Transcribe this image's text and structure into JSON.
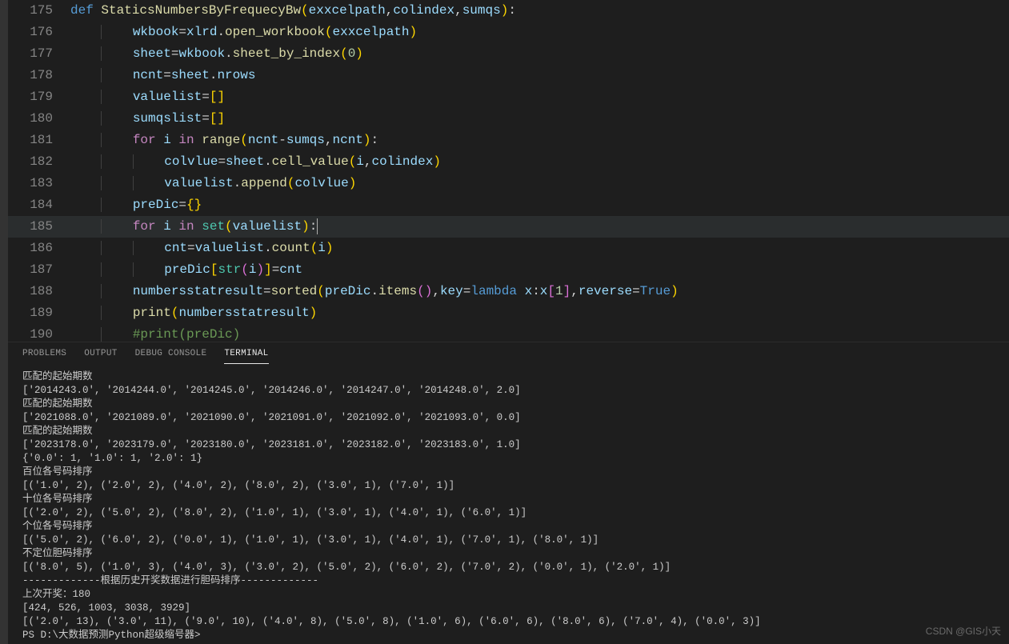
{
  "editor": {
    "lines": [
      {
        "num": "175",
        "hl": false,
        "tokens": [
          {
            "t": "def ",
            "c": "kw"
          },
          {
            "t": "StaticsNumbersByFrequecyBw",
            "c": "fn"
          },
          {
            "t": "(",
            "c": "br1"
          },
          {
            "t": "exxcelpath",
            "c": "var"
          },
          {
            "t": ",",
            "c": "pn"
          },
          {
            "t": "colindex",
            "c": "var"
          },
          {
            "t": ",",
            "c": "pn"
          },
          {
            "t": "sumqs",
            "c": "var"
          },
          {
            "t": ")",
            "c": "br1"
          },
          {
            "t": ":",
            "c": "pn"
          }
        ]
      },
      {
        "num": "176",
        "hl": false,
        "indent": 2,
        "tokens": [
          {
            "t": "wkbook",
            "c": "var"
          },
          {
            "t": "=",
            "c": "op"
          },
          {
            "t": "xlrd",
            "c": "var"
          },
          {
            "t": ".",
            "c": "pn"
          },
          {
            "t": "open_workbook",
            "c": "fn"
          },
          {
            "t": "(",
            "c": "br1"
          },
          {
            "t": "exxcelpath",
            "c": "var"
          },
          {
            "t": ")",
            "c": "br1"
          }
        ]
      },
      {
        "num": "177",
        "hl": false,
        "indent": 2,
        "tokens": [
          {
            "t": "sheet",
            "c": "var"
          },
          {
            "t": "=",
            "c": "op"
          },
          {
            "t": "wkbook",
            "c": "var"
          },
          {
            "t": ".",
            "c": "pn"
          },
          {
            "t": "sheet_by_index",
            "c": "fn"
          },
          {
            "t": "(",
            "c": "br1"
          },
          {
            "t": "0",
            "c": "num"
          },
          {
            "t": ")",
            "c": "br1"
          }
        ]
      },
      {
        "num": "178",
        "hl": false,
        "indent": 2,
        "tokens": [
          {
            "t": "ncnt",
            "c": "var"
          },
          {
            "t": "=",
            "c": "op"
          },
          {
            "t": "sheet",
            "c": "var"
          },
          {
            "t": ".",
            "c": "pn"
          },
          {
            "t": "nrows",
            "c": "var"
          }
        ]
      },
      {
        "num": "179",
        "hl": false,
        "indent": 2,
        "tokens": [
          {
            "t": "valuelist",
            "c": "var"
          },
          {
            "t": "=",
            "c": "op"
          },
          {
            "t": "[",
            "c": "br1"
          },
          {
            "t": "]",
            "c": "br1"
          }
        ]
      },
      {
        "num": "180",
        "hl": false,
        "indent": 2,
        "tokens": [
          {
            "t": "sumqslist",
            "c": "var"
          },
          {
            "t": "=",
            "c": "op"
          },
          {
            "t": "[",
            "c": "br1"
          },
          {
            "t": "]",
            "c": "br1"
          }
        ]
      },
      {
        "num": "181",
        "hl": false,
        "indent": 2,
        "tokens": [
          {
            "t": "for ",
            "c": "kw2"
          },
          {
            "t": "i",
            "c": "var"
          },
          {
            "t": " in ",
            "c": "kw2"
          },
          {
            "t": "range",
            "c": "fn"
          },
          {
            "t": "(",
            "c": "br1"
          },
          {
            "t": "ncnt",
            "c": "var"
          },
          {
            "t": "-",
            "c": "op"
          },
          {
            "t": "sumqs",
            "c": "var"
          },
          {
            "t": ",",
            "c": "pn"
          },
          {
            "t": "ncnt",
            "c": "var"
          },
          {
            "t": ")",
            "c": "br1"
          },
          {
            "t": ":",
            "c": "pn"
          }
        ]
      },
      {
        "num": "182",
        "hl": false,
        "indent": 3,
        "tokens": [
          {
            "t": "colvlue",
            "c": "var"
          },
          {
            "t": "=",
            "c": "op"
          },
          {
            "t": "sheet",
            "c": "var"
          },
          {
            "t": ".",
            "c": "pn"
          },
          {
            "t": "cell_value",
            "c": "fn"
          },
          {
            "t": "(",
            "c": "br1"
          },
          {
            "t": "i",
            "c": "var"
          },
          {
            "t": ",",
            "c": "pn"
          },
          {
            "t": "colindex",
            "c": "var"
          },
          {
            "t": ")",
            "c": "br1"
          }
        ]
      },
      {
        "num": "183",
        "hl": false,
        "indent": 3,
        "tokens": [
          {
            "t": "valuelist",
            "c": "var"
          },
          {
            "t": ".",
            "c": "pn"
          },
          {
            "t": "append",
            "c": "fn"
          },
          {
            "t": "(",
            "c": "br1"
          },
          {
            "t": "colvlue",
            "c": "var"
          },
          {
            "t": ")",
            "c": "br1"
          }
        ]
      },
      {
        "num": "184",
        "hl": false,
        "indent": 2,
        "tokens": [
          {
            "t": "preDic",
            "c": "var"
          },
          {
            "t": "=",
            "c": "op"
          },
          {
            "t": "{",
            "c": "br1"
          },
          {
            "t": "}",
            "c": "br1"
          }
        ]
      },
      {
        "num": "185",
        "hl": true,
        "indent": 2,
        "tokens": [
          {
            "t": "for ",
            "c": "kw2"
          },
          {
            "t": "i",
            "c": "var"
          },
          {
            "t": " in ",
            "c": "kw2"
          },
          {
            "t": "set",
            "c": "cls"
          },
          {
            "t": "(",
            "c": "br1"
          },
          {
            "t": "valuelist",
            "c": "var"
          },
          {
            "t": ")",
            "c": "br1"
          },
          {
            "t": ":",
            "c": "pn"
          }
        ],
        "cursor_after": true
      },
      {
        "num": "186",
        "hl": false,
        "indent": 3,
        "tokens": [
          {
            "t": "cnt",
            "c": "var"
          },
          {
            "t": "=",
            "c": "op"
          },
          {
            "t": "valuelist",
            "c": "var"
          },
          {
            "t": ".",
            "c": "pn"
          },
          {
            "t": "count",
            "c": "fn"
          },
          {
            "t": "(",
            "c": "br1"
          },
          {
            "t": "i",
            "c": "var"
          },
          {
            "t": ")",
            "c": "br1"
          }
        ]
      },
      {
        "num": "187",
        "hl": false,
        "indent": 3,
        "tokens": [
          {
            "t": "preDic",
            "c": "var"
          },
          {
            "t": "[",
            "c": "br1"
          },
          {
            "t": "str",
            "c": "cls"
          },
          {
            "t": "(",
            "c": "br2"
          },
          {
            "t": "i",
            "c": "var"
          },
          {
            "t": ")",
            "c": "br2"
          },
          {
            "t": "]",
            "c": "br1"
          },
          {
            "t": "=",
            "c": "op"
          },
          {
            "t": "cnt",
            "c": "var"
          }
        ]
      },
      {
        "num": "188",
        "hl": false,
        "indent": 2,
        "tokens": [
          {
            "t": "numbersstatresult",
            "c": "var"
          },
          {
            "t": "=",
            "c": "op"
          },
          {
            "t": "sorted",
            "c": "fn"
          },
          {
            "t": "(",
            "c": "br1"
          },
          {
            "t": "preDic",
            "c": "var"
          },
          {
            "t": ".",
            "c": "pn"
          },
          {
            "t": "items",
            "c": "fn"
          },
          {
            "t": "(",
            "c": "br2"
          },
          {
            "t": ")",
            "c": "br2"
          },
          {
            "t": ",",
            "c": "pn"
          },
          {
            "t": "key",
            "c": "var"
          },
          {
            "t": "=",
            "c": "op"
          },
          {
            "t": "lambda ",
            "c": "kw"
          },
          {
            "t": "x",
            "c": "var"
          },
          {
            "t": ":",
            "c": "pn"
          },
          {
            "t": "x",
            "c": "var"
          },
          {
            "t": "[",
            "c": "br2"
          },
          {
            "t": "1",
            "c": "num"
          },
          {
            "t": "]",
            "c": "br2"
          },
          {
            "t": ",",
            "c": "pn"
          },
          {
            "t": "reverse",
            "c": "var"
          },
          {
            "t": "=",
            "c": "op"
          },
          {
            "t": "True",
            "c": "const"
          },
          {
            "t": ")",
            "c": "br1"
          }
        ]
      },
      {
        "num": "189",
        "hl": false,
        "indent": 2,
        "tokens": [
          {
            "t": "print",
            "c": "fn"
          },
          {
            "t": "(",
            "c": "br1"
          },
          {
            "t": "numbersstatresult",
            "c": "var"
          },
          {
            "t": ")",
            "c": "br1"
          }
        ]
      },
      {
        "num": "190",
        "hl": false,
        "indent": 2,
        "tokens": [
          {
            "t": "#print(preDic)",
            "c": "cmt"
          }
        ]
      }
    ]
  },
  "panel": {
    "tabs": [
      {
        "label": "PROBLEMS",
        "active": false
      },
      {
        "label": "OUTPUT",
        "active": false
      },
      {
        "label": "DEBUG CONSOLE",
        "active": false
      },
      {
        "label": "TERMINAL",
        "active": true
      }
    ],
    "terminal_lines": [
      "匹配的起始期数",
      "['2014243.0', '2014244.0', '2014245.0', '2014246.0', '2014247.0', '2014248.0', 2.0]",
      "匹配的起始期数",
      "['2021088.0', '2021089.0', '2021090.0', '2021091.0', '2021092.0', '2021093.0', 0.0]",
      "匹配的起始期数",
      "['2023178.0', '2023179.0', '2023180.0', '2023181.0', '2023182.0', '2023183.0', 1.0]",
      "{'0.0': 1, '1.0': 1, '2.0': 1}",
      "百位各号码排序",
      "[('1.0', 2), ('2.0', 2), ('4.0', 2), ('8.0', 2), ('3.0', 1), ('7.0', 1)]",
      "十位各号码排序",
      "[('2.0', 2), ('5.0', 2), ('8.0', 2), ('1.0', 1), ('3.0', 1), ('4.0', 1), ('6.0', 1)]",
      "个位各号码排序",
      "[('5.0', 2), ('6.0', 2), ('0.0', 1), ('1.0', 1), ('3.0', 1), ('4.0', 1), ('7.0', 1), ('8.0', 1)]",
      "不定位胆码排序",
      "[('8.0', 5), ('1.0', 3), ('4.0', 3), ('3.0', 2), ('5.0', 2), ('6.0', 2), ('7.0', 2), ('0.0', 1), ('2.0', 1)]",
      "-------------根据历史开奖数据进行胆码排序-------------",
      "上次开奖：180",
      "[424, 526, 1003, 3038, 3929]",
      "[('2.0', 13), ('3.0', 11), ('9.0', 10), ('4.0', 8), ('5.0', 8), ('1.0', 6), ('6.0', 6), ('8.0', 6), ('7.0', 4), ('0.0', 3)]",
      "PS D:\\大数据预测Python超级缩号器>"
    ]
  },
  "watermark": "CSDN @GIS小天"
}
